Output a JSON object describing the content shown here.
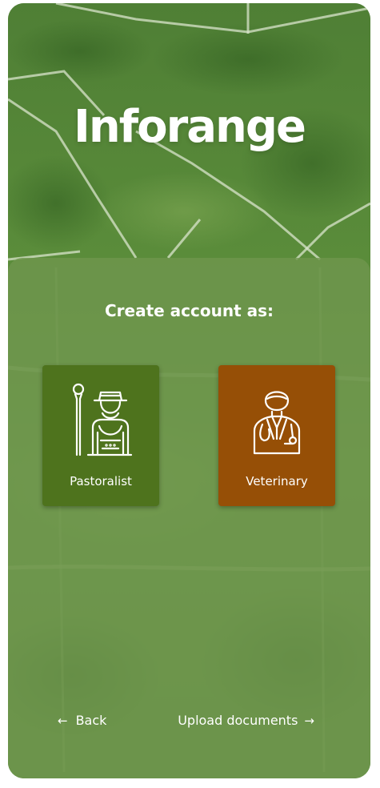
{
  "app": {
    "brand": "Inforange"
  },
  "signup": {
    "heading": "Create account as:",
    "roles": [
      {
        "label": "Pastoralist",
        "icon": "pastoralist-icon",
        "color": "#4e731d"
      },
      {
        "label": "Veterinary",
        "icon": "veterinarian-icon",
        "color": "#964f06"
      }
    ]
  },
  "nav": {
    "back_label": "Back",
    "next_label": "Upload documents",
    "back_icon": "arrow-left-icon",
    "next_icon": "arrow-right-icon"
  },
  "theme": {
    "background_green": "#5d8c3e",
    "text": "#ffffff"
  }
}
